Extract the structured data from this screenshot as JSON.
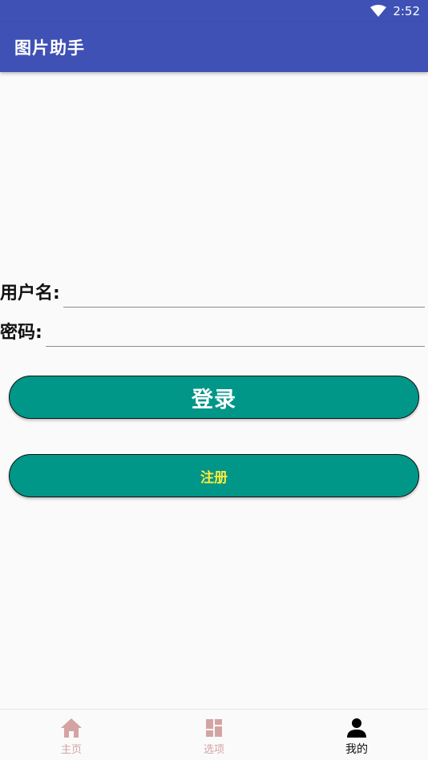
{
  "status_bar": {
    "time": "2:52",
    "icons": [
      "wifi-icon"
    ]
  },
  "app_bar": {
    "title": "图片助手",
    "color": "#3f51b5"
  },
  "form": {
    "username_label": "用户名:",
    "username_value": "",
    "password_label": "密码:",
    "password_value": ""
  },
  "buttons": {
    "login_label": "登录",
    "register_label": "注册",
    "color": "#009688"
  },
  "bottom_nav": {
    "items": [
      {
        "label": "主页",
        "icon": "home-icon",
        "active": false
      },
      {
        "label": "选项",
        "icon": "dashboard-icon",
        "active": false
      },
      {
        "label": "我的",
        "icon": "person-icon",
        "active": true
      }
    ]
  }
}
